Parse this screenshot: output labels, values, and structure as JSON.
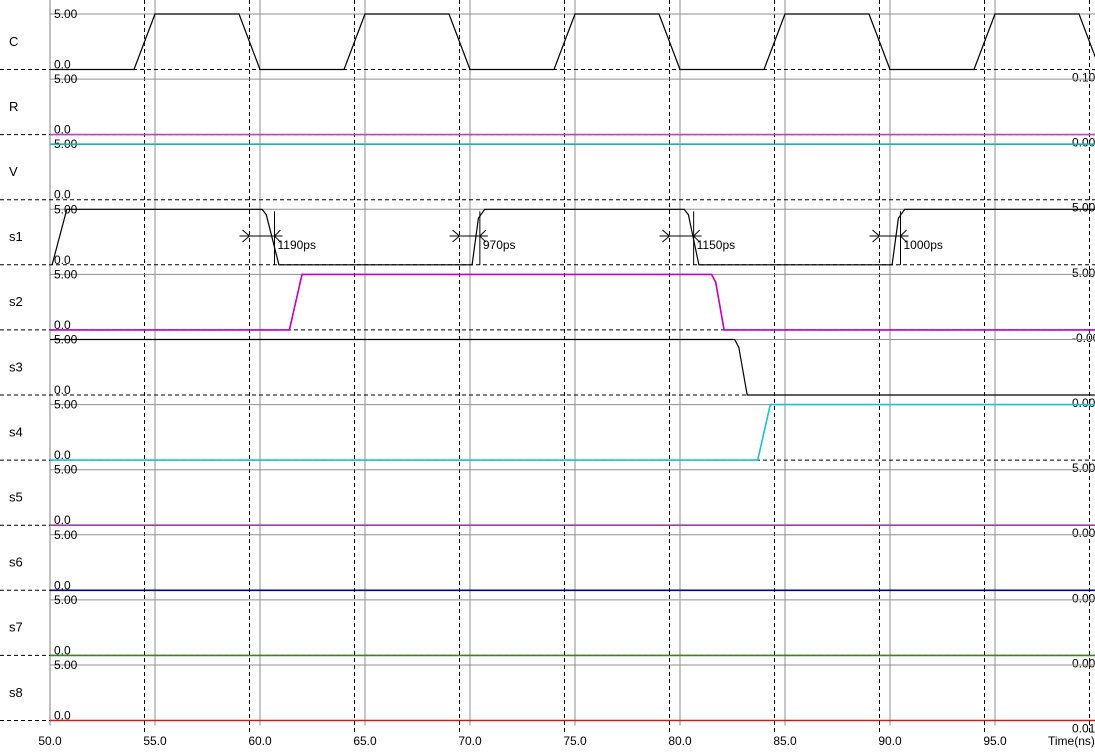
{
  "chart_data": {
    "type": "line",
    "title": "",
    "xlabel": "Time(ns)",
    "xlim": [
      50.0,
      99.76
    ],
    "x_ticks": [
      "50.0",
      "55.0",
      "60.0",
      "65.0",
      "70.0",
      "75.0",
      "80.0",
      "85.0",
      "90.0",
      "95.0"
    ],
    "x_tick_values": [
      50,
      55,
      60,
      65,
      70,
      75,
      80,
      85,
      90,
      95
    ],
    "dashed_markers": [
      54.5,
      59.5,
      64.5,
      69.5,
      74.5,
      79.5,
      84.5,
      89.5,
      94.5,
      99.5
    ],
    "ylim": [
      0,
      5
    ],
    "series": [
      {
        "name": "C",
        "color": "#000000",
        "top_label": "5.00",
        "bottom_label": "0.0",
        "right_label": "0.10",
        "points": [
          [
            50,
            0
          ],
          [
            54,
            0
          ],
          [
            55,
            5
          ],
          [
            59,
            5
          ],
          [
            60,
            0
          ],
          [
            64,
            0
          ],
          [
            65,
            5
          ],
          [
            69,
            5
          ],
          [
            70,
            0
          ],
          [
            74,
            0
          ],
          [
            75,
            5
          ],
          [
            79,
            5
          ],
          [
            80,
            0
          ],
          [
            84,
            0
          ],
          [
            85,
            5
          ],
          [
            89,
            5
          ],
          [
            90,
            0
          ],
          [
            94,
            0
          ],
          [
            95,
            5
          ],
          [
            99,
            5
          ],
          [
            99.8,
            1
          ]
        ]
      },
      {
        "name": "R",
        "color": "#c040c0",
        "top_label": "5.00",
        "bottom_label": "0.0",
        "right_label": "0.00",
        "points": [
          [
            50,
            0
          ],
          [
            99.8,
            0
          ]
        ]
      },
      {
        "name": "V",
        "color": "#20b0b0",
        "top_label": "5.00",
        "bottom_label": "0.0",
        "right_label": "5.00",
        "points": [
          [
            50,
            5
          ],
          [
            99.8,
            5
          ]
        ]
      },
      {
        "name": "s1",
        "color": "#000000",
        "top_label": "5.00",
        "bottom_label": "0.0",
        "right_label": "5.00",
        "points": [
          [
            50.1,
            0
          ],
          [
            50.8,
            5
          ],
          [
            60.1,
            5
          ],
          [
            60.3,
            4.5
          ],
          [
            60.9,
            0
          ],
          [
            70.1,
            0
          ],
          [
            70.4,
            4.2
          ],
          [
            70.7,
            5
          ],
          [
            80.2,
            5
          ],
          [
            80.4,
            4.5
          ],
          [
            80.9,
            0
          ],
          [
            90.1,
            0
          ],
          [
            90.4,
            4.2
          ],
          [
            90.7,
            5
          ],
          [
            99.8,
            5
          ]
        ]
      },
      {
        "name": "s2",
        "color": "#c000c0",
        "top_label": "5.00",
        "bottom_label": "0.0",
        "right_label": "-0.00",
        "points": [
          [
            50,
            0
          ],
          [
            61.4,
            0
          ],
          [
            62.0,
            5
          ],
          [
            81.5,
            5
          ],
          [
            81.7,
            4.3
          ],
          [
            82.1,
            0
          ],
          [
            99.8,
            0
          ]
        ]
      },
      {
        "name": "s3",
        "color": "#000000",
        "top_label": "5.00",
        "bottom_label": "0.0",
        "right_label": "0.00",
        "points": [
          [
            50,
            5
          ],
          [
            82.6,
            5
          ],
          [
            82.8,
            4.3
          ],
          [
            83.2,
            0
          ],
          [
            99.8,
            0
          ]
        ]
      },
      {
        "name": "s4",
        "color": "#20c0d0",
        "top_label": "5.00",
        "bottom_label": "0.0",
        "right_label": "5.00",
        "points": [
          [
            50,
            0
          ],
          [
            83.7,
            0
          ],
          [
            84.3,
            5
          ],
          [
            99.8,
            5
          ]
        ]
      },
      {
        "name": "s5",
        "color": "#a040a0",
        "top_label": "5.00",
        "bottom_label": "0.0",
        "right_label": "0.00",
        "points": [
          [
            50,
            0
          ],
          [
            99.8,
            0
          ]
        ]
      },
      {
        "name": "s6",
        "color": "#000080",
        "top_label": "5.00",
        "bottom_label": "0.0",
        "right_label": "0.00",
        "points": [
          [
            50,
            0
          ],
          [
            99.8,
            0
          ]
        ]
      },
      {
        "name": "s7",
        "color": "#408020",
        "top_label": "5.00",
        "bottom_label": "0.0",
        "right_label": "0.00",
        "points": [
          [
            50,
            0
          ],
          [
            99.8,
            0
          ]
        ]
      },
      {
        "name": "s8",
        "color": "#c02020",
        "top_label": "5.00",
        "bottom_label": "0.0",
        "right_label": "0.01",
        "points": [
          [
            50,
            0
          ],
          [
            99.8,
            0
          ]
        ]
      }
    ],
    "measurements": [
      {
        "signal": "s1",
        "from": 59.5,
        "to": 60.69,
        "label": "1190ps"
      },
      {
        "signal": "s1",
        "from": 69.5,
        "to": 70.47,
        "label": "970ps"
      },
      {
        "signal": "s1",
        "from": 79.5,
        "to": 80.65,
        "label": "1150ps"
      },
      {
        "signal": "s1",
        "from": 89.5,
        "to": 90.5,
        "label": "1000ps"
      }
    ]
  }
}
